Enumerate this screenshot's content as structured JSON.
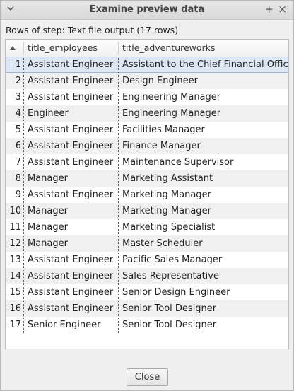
{
  "window": {
    "title": "Examine preview data"
  },
  "subtitle": "Rows of step: Text file output (17 rows)",
  "table": {
    "columns": [
      "title_employees",
      "title_adventureworks"
    ],
    "rows": [
      {
        "n": "1",
        "a": "Assistant Engineer",
        "b": "Assistant to the Chief Financial Officer"
      },
      {
        "n": "2",
        "a": "Assistant Engineer",
        "b": "Design Engineer"
      },
      {
        "n": "3",
        "a": "Assistant Engineer",
        "b": "Engineering Manager"
      },
      {
        "n": "4",
        "a": "Engineer",
        "b": "Engineering Manager"
      },
      {
        "n": "5",
        "a": "Assistant Engineer",
        "b": "Facilities Manager"
      },
      {
        "n": "6",
        "a": "Assistant Engineer",
        "b": "Finance Manager"
      },
      {
        "n": "7",
        "a": "Assistant Engineer",
        "b": "Maintenance Supervisor"
      },
      {
        "n": "8",
        "a": "Manager",
        "b": "Marketing Assistant"
      },
      {
        "n": "9",
        "a": "Assistant Engineer",
        "b": "Marketing Manager"
      },
      {
        "n": "10",
        "a": "Manager",
        "b": "Marketing Manager"
      },
      {
        "n": "11",
        "a": "Manager",
        "b": "Marketing Specialist"
      },
      {
        "n": "12",
        "a": "Manager",
        "b": "Master Scheduler"
      },
      {
        "n": "13",
        "a": "Assistant Engineer",
        "b": "Pacific Sales Manager"
      },
      {
        "n": "14",
        "a": "Assistant Engineer",
        "b": "Sales Representative"
      },
      {
        "n": "15",
        "a": "Assistant Engineer",
        "b": "Senior Design Engineer"
      },
      {
        "n": "16",
        "a": "Assistant Engineer",
        "b": "Senior Tool Designer"
      },
      {
        "n": "17",
        "a": "Senior Engineer",
        "b": "Senior Tool Designer"
      }
    ]
  },
  "buttons": {
    "close": "Close"
  },
  "icons": {
    "window_menu": "chevron-down-icon",
    "maximize": "plus-icon",
    "close": "close-icon",
    "sort": "sort-ascending-icon"
  }
}
